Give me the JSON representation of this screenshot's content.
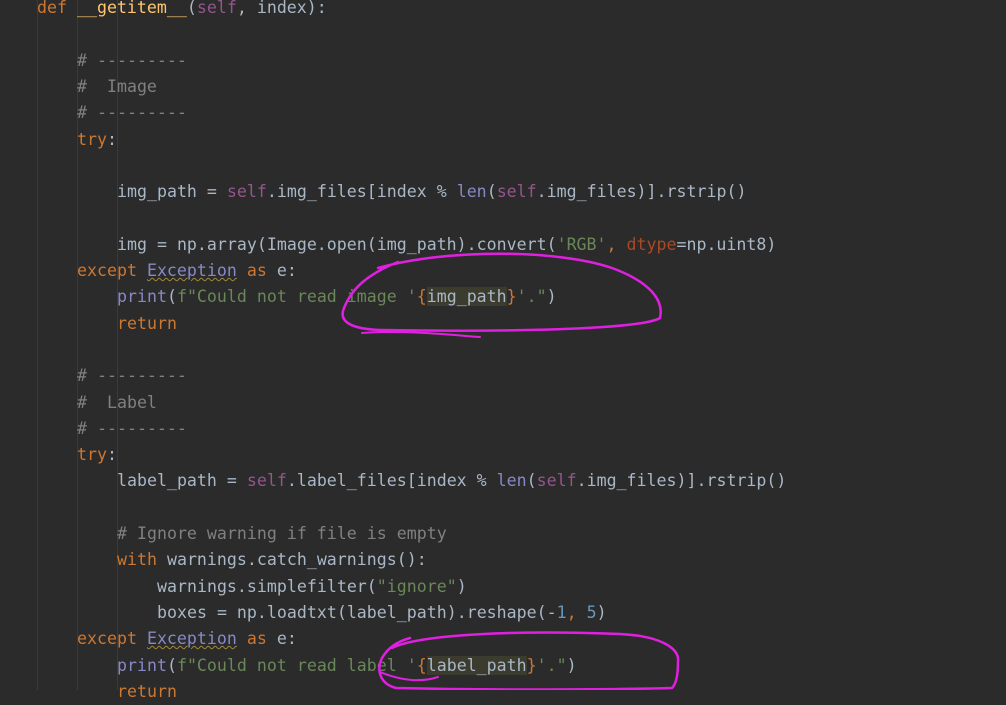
{
  "code": {
    "lines": [
      {
        "indent": 0,
        "tokens": [
          {
            "t": "def",
            "c": "kw"
          },
          {
            "t": " "
          },
          {
            "t": "__getitem__",
            "c": "fn"
          },
          {
            "t": "("
          },
          {
            "t": "self",
            "c": "slf"
          },
          {
            "t": ", index):"
          }
        ]
      },
      {
        "indent": 0,
        "tokens": []
      },
      {
        "indent": 1,
        "tokens": [
          {
            "t": "# ---------",
            "c": "cm"
          }
        ]
      },
      {
        "indent": 1,
        "tokens": [
          {
            "t": "#  Image",
            "c": "cm"
          }
        ]
      },
      {
        "indent": 1,
        "tokens": [
          {
            "t": "# ---------",
            "c": "cm"
          }
        ]
      },
      {
        "indent": 1,
        "tokens": [
          {
            "t": "try",
            "c": "kw"
          },
          {
            "t": ":"
          }
        ]
      },
      {
        "indent": 0,
        "tokens": []
      },
      {
        "indent": 2,
        "tokens": [
          {
            "t": "img_path = "
          },
          {
            "t": "self",
            "c": "slf"
          },
          {
            "t": ".img_files[index % "
          },
          {
            "t": "len",
            "c": "bi"
          },
          {
            "t": "("
          },
          {
            "t": "self",
            "c": "slf"
          },
          {
            "t": ".img_files)].rstrip()"
          }
        ]
      },
      {
        "indent": 0,
        "tokens": []
      },
      {
        "indent": 2,
        "tokens": [
          {
            "t": "img = np.array(Image.open(img_path).convert("
          },
          {
            "t": "'RGB'",
            "c": "st"
          },
          {
            "t": ", ",
            "c": "kw"
          },
          {
            "t": "dtype",
            "c": "pr"
          },
          {
            "t": "=np.uint8)"
          }
        ]
      },
      {
        "indent": 1,
        "tokens": [
          {
            "t": "except",
            "c": "kw"
          },
          {
            "t": " "
          },
          {
            "t": "Exception",
            "c": "bi",
            "w": true
          },
          {
            "t": " "
          },
          {
            "t": "as",
            "c": "kw"
          },
          {
            "t": " e:"
          }
        ]
      },
      {
        "indent": 2,
        "tokens": [
          {
            "t": "print",
            "c": "bi"
          },
          {
            "t": "("
          },
          {
            "t": "f\"Could not read image '",
            "c": "st"
          },
          {
            "t": "{",
            "c": "fb"
          },
          {
            "t": "img_path",
            "c": "fe"
          },
          {
            "t": "}",
            "c": "fb"
          },
          {
            "t": "'.\"",
            "c": "st"
          },
          {
            "t": ")"
          }
        ]
      },
      {
        "indent": 2,
        "tokens": [
          {
            "t": "return",
            "c": "kw"
          }
        ]
      },
      {
        "indent": 0,
        "tokens": []
      },
      {
        "indent": 1,
        "tokens": [
          {
            "t": "# ---------",
            "c": "cm"
          }
        ]
      },
      {
        "indent": 1,
        "tokens": [
          {
            "t": "#  Label",
            "c": "cm"
          }
        ]
      },
      {
        "indent": 1,
        "tokens": [
          {
            "t": "# ---------",
            "c": "cm"
          }
        ]
      },
      {
        "indent": 1,
        "tokens": [
          {
            "t": "try",
            "c": "kw"
          },
          {
            "t": ":"
          }
        ]
      },
      {
        "indent": 2,
        "tokens": [
          {
            "t": "label_path = "
          },
          {
            "t": "self",
            "c": "slf"
          },
          {
            "t": ".label_files[index % "
          },
          {
            "t": "len",
            "c": "bi"
          },
          {
            "t": "("
          },
          {
            "t": "self",
            "c": "slf"
          },
          {
            "t": ".img_files)].rstrip()"
          }
        ]
      },
      {
        "indent": 0,
        "tokens": []
      },
      {
        "indent": 2,
        "tokens": [
          {
            "t": "# Ignore warning if file is empty",
            "c": "cm"
          }
        ]
      },
      {
        "indent": 2,
        "tokens": [
          {
            "t": "with",
            "c": "kw"
          },
          {
            "t": " warnings.catch_warnings():"
          }
        ]
      },
      {
        "indent": 3,
        "tokens": [
          {
            "t": "warnings.simplefilter("
          },
          {
            "t": "\"ignore\"",
            "c": "st"
          },
          {
            "t": ")"
          }
        ]
      },
      {
        "indent": 3,
        "tokens": [
          {
            "t": "boxes = np.loadtxt(label_path).reshape(-"
          },
          {
            "t": "1",
            "c": "nm"
          },
          {
            "t": ", ",
            "c": "kw"
          },
          {
            "t": "5",
            "c": "nm"
          },
          {
            "t": ")"
          }
        ]
      },
      {
        "indent": 1,
        "tokens": [
          {
            "t": "except",
            "c": "kw"
          },
          {
            "t": " "
          },
          {
            "t": "Exception",
            "c": "bi",
            "w": true
          },
          {
            "t": " "
          },
          {
            "t": "as",
            "c": "kw"
          },
          {
            "t": " e:"
          }
        ]
      },
      {
        "indent": 2,
        "tokens": [
          {
            "t": "print",
            "c": "bi"
          },
          {
            "t": "("
          },
          {
            "t": "f\"Could not read label '",
            "c": "st"
          },
          {
            "t": "{",
            "c": "fb"
          },
          {
            "t": "label_path",
            "c": "fe"
          },
          {
            "t": "}",
            "c": "fb"
          },
          {
            "t": "'.\"",
            "c": "st"
          },
          {
            "t": ")"
          }
        ]
      },
      {
        "indent": 2,
        "tokens": [
          {
            "t": "return",
            "c": "kw"
          }
        ]
      }
    ]
  },
  "theme": {
    "background": "#2b2b2b",
    "keyword": "#cc7832",
    "function": "#ffc66d",
    "self": "#94558d",
    "builtin": "#8888c6",
    "string": "#6a8759",
    "number": "#6897bb",
    "comment": "#808080",
    "annotation": "#e020e0"
  }
}
